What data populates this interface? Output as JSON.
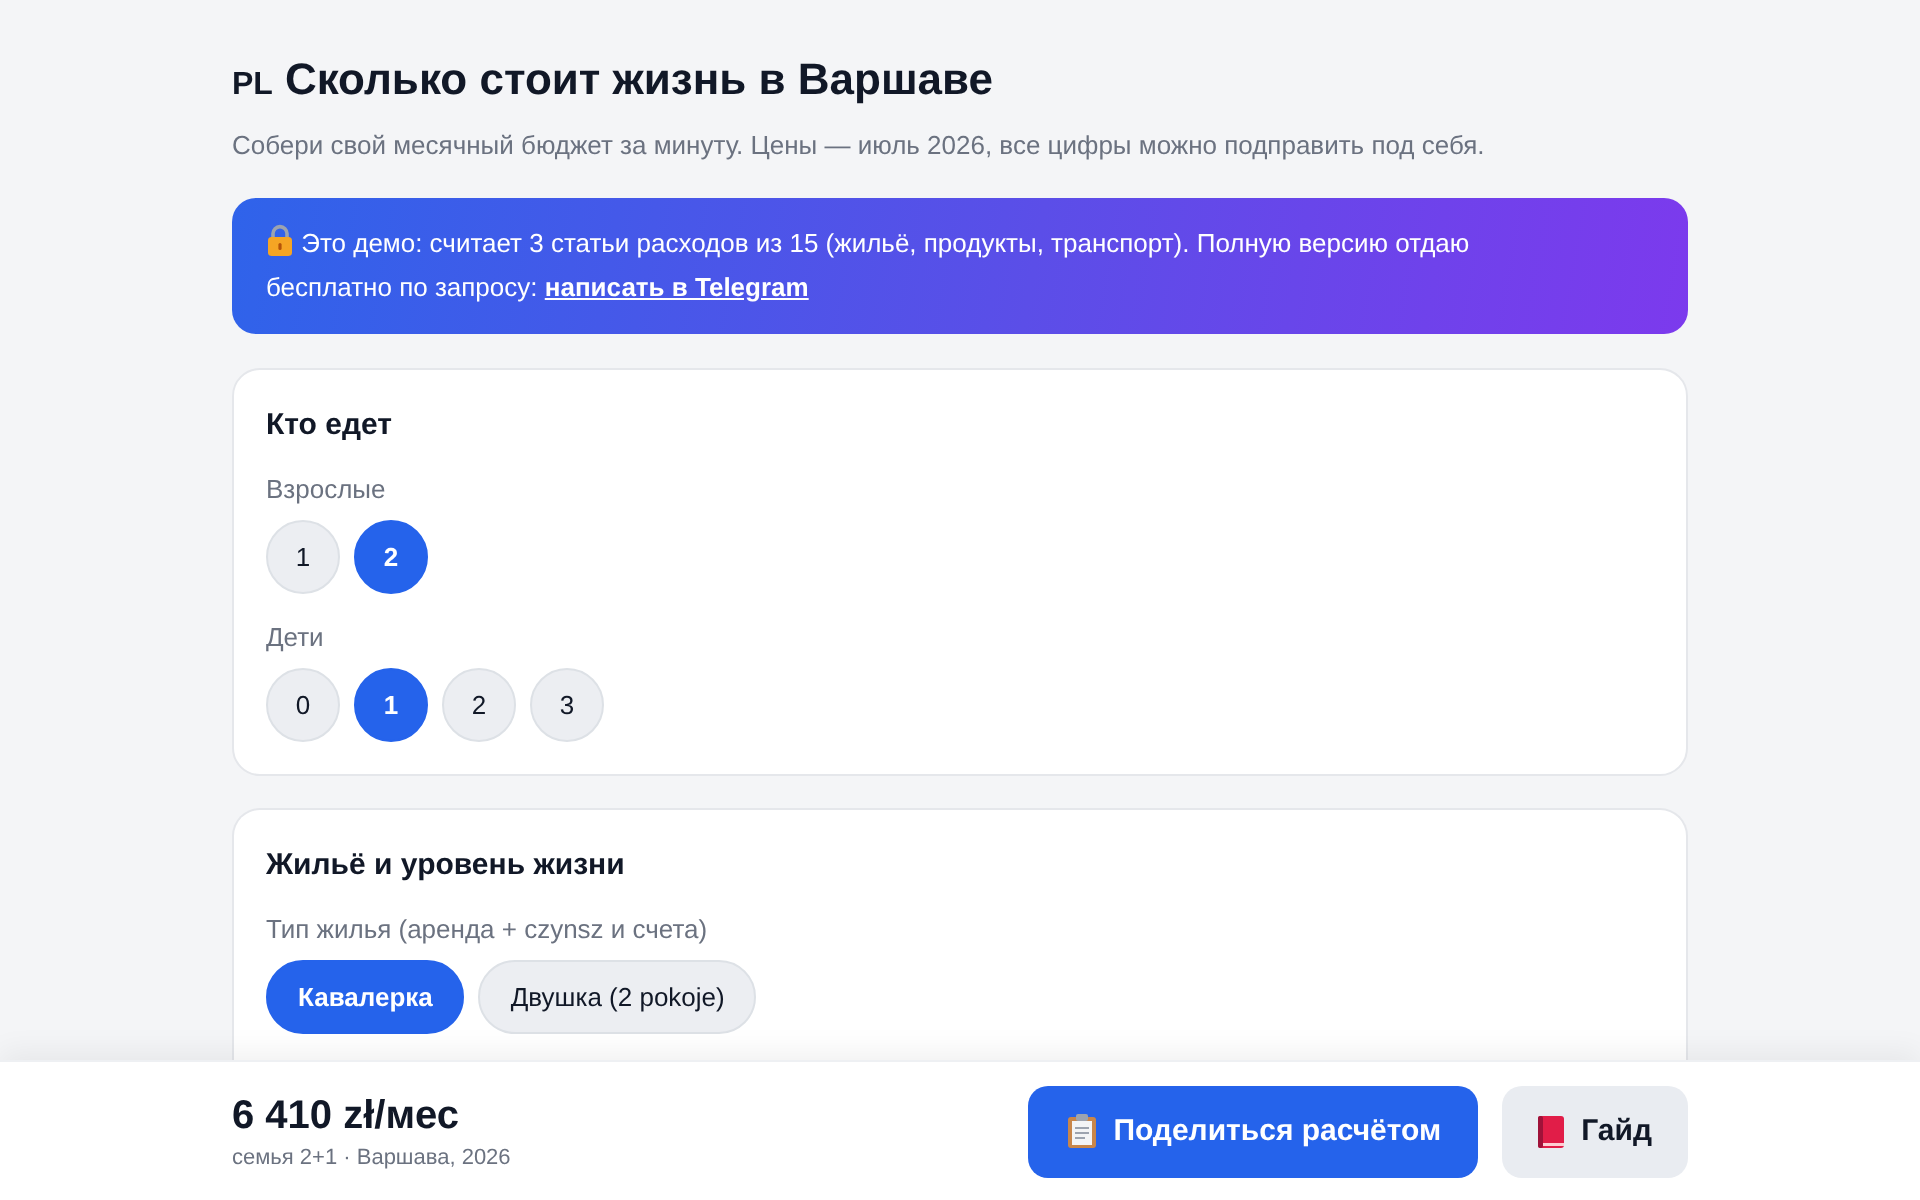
{
  "header": {
    "flag": "PL",
    "title": "Сколько стоит жизнь в Варшаве",
    "subtitle": "Собери свой месячный бюджет за минуту. Цены — июль 2026, все цифры можно подправить под себя."
  },
  "banner": {
    "text": "Это демо: считает 3 статьи расходов из 15 (жильё, продукты, транспорт). Полную версию отдаю бесплатно по запросу:",
    "link": "написать в Telegram"
  },
  "sections": [
    {
      "title": "Кто едет",
      "groups": [
        {
          "label": "Взрослые",
          "kind": "round",
          "options": [
            {
              "label": "1",
              "selected": false
            },
            {
              "label": "2",
              "selected": true
            }
          ]
        },
        {
          "label": "Дети",
          "kind": "round",
          "options": [
            {
              "label": "0",
              "selected": false
            },
            {
              "label": "1",
              "selected": true
            },
            {
              "label": "2",
              "selected": false
            },
            {
              "label": "3",
              "selected": false
            }
          ]
        }
      ]
    },
    {
      "title": "Жильё и уровень жизни",
      "groups": [
        {
          "label": "Тип жилья (аренда + czynsz и счета)",
          "kind": "pill",
          "options": [
            {
              "label": "Кавалерка",
              "selected": true
            },
            {
              "label": "Двушка (2 pokoje)",
              "selected": false
            }
          ]
        }
      ]
    }
  ],
  "footer": {
    "total": "6 410 zł/мес",
    "summary": "семья 2+1 · Варшава, 2026",
    "buttons": [
      {
        "label": "Поделиться расчётом",
        "kind": "primary"
      },
      {
        "label": "Гайд",
        "kind": "secondary"
      }
    ]
  }
}
